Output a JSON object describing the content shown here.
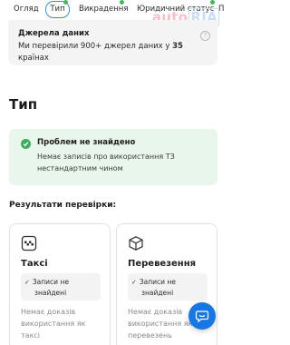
{
  "tabs": [
    {
      "label": "Огляд"
    },
    {
      "label": "Тип"
    },
    {
      "label": "Викрадення"
    },
    {
      "label": "Юридичний статус"
    },
    {
      "label": "П"
    }
  ],
  "logo": {
    "text_auto": "auto",
    "text_ria": "RIA"
  },
  "sources": {
    "title": "Джерела даних",
    "text_prefix": "Ми перевірили 900+ джерел даних у ",
    "count": "35",
    "text_suffix": " країнах"
  },
  "section_title": "Тип",
  "status": {
    "title": "Проблем не знайдено",
    "text": "Немає записів про використання ТЗ нестандартним чином"
  },
  "results_title": "Результати перевірки:",
  "cards": [
    {
      "title": "Таксі",
      "pill_line1": "Записи не",
      "pill_line2": "знайдені",
      "text": "Немає доказів використання як таксі",
      "icon": "taxi-icon"
    },
    {
      "title": "Перевезення",
      "pill_line1": "Записи не",
      "pill_line2": "знайдені",
      "text": "Немає доказів використання як для перевезень",
      "icon": "box-icon"
    }
  ],
  "colors": {
    "accent": "#1677e5",
    "success": "#3fae5c",
    "status_bg": "#e9f6ec"
  }
}
